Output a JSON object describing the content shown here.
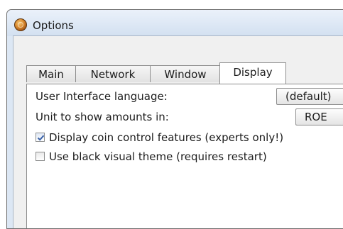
{
  "window": {
    "title": "Options",
    "app_icon": "coin-icon"
  },
  "tabs": [
    {
      "label": "Main",
      "active": false
    },
    {
      "label": "Network",
      "active": false
    },
    {
      "label": "Window",
      "active": false
    },
    {
      "label": "Display",
      "active": true
    }
  ],
  "display": {
    "language_label": "User Interface language:",
    "language_value": "(default)",
    "unit_label": "Unit to show amounts in:",
    "unit_value": "ROE",
    "coin_control_label": "Display coin control features (experts only!)",
    "coin_control_checked": true,
    "black_theme_label": "Use black visual theme (requires restart)",
    "black_theme_checked": false
  },
  "colors": {
    "titlebar": "#dce7f4",
    "checkmark": "#3b62a8"
  }
}
